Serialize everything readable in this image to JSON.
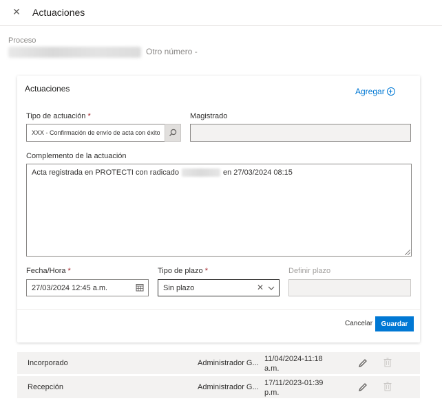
{
  "header": {
    "title": "Actuaciones"
  },
  "proceso": {
    "label": "Proceso",
    "other": "Otro número  -"
  },
  "form": {
    "title": "Actuaciones",
    "add_label": "Agregar",
    "tipo": {
      "label": "Tipo de actuación",
      "required": "*",
      "value": "XXX - Confirmación de envío de acta con éxito a PROTECTI"
    },
    "magistrado": {
      "label": "Magistrado",
      "value": ""
    },
    "complemento": {
      "label": "Complemento de la actuación",
      "text_before": "Acta registrada en PROTECTI con radicado",
      "text_after": "en 27/03/2024 08:15"
    },
    "fecha": {
      "label": "Fecha/Hora",
      "required": "*",
      "value": "27/03/2024 12:45 a.m."
    },
    "plazo": {
      "label": "Tipo de plazo",
      "required": "*",
      "value": "Sin plazo"
    },
    "definir": {
      "label": "Definir plazo",
      "value": ""
    },
    "cancel_label": "Cancelar",
    "save_label": "Guardar"
  },
  "rows": [
    {
      "status": "Incorporado",
      "user": "Administrador G...",
      "date_line1": "11/04/2024-11:18",
      "date_line2": "a.m."
    },
    {
      "status": "Recepción",
      "user": "Administrador G...",
      "date_line1": "17/11/2023-01:39",
      "date_line2": "p.m."
    }
  ],
  "colors": {
    "accent": "#0078d4",
    "required": "#a4262c",
    "row_bg": "#f3f2f1"
  }
}
